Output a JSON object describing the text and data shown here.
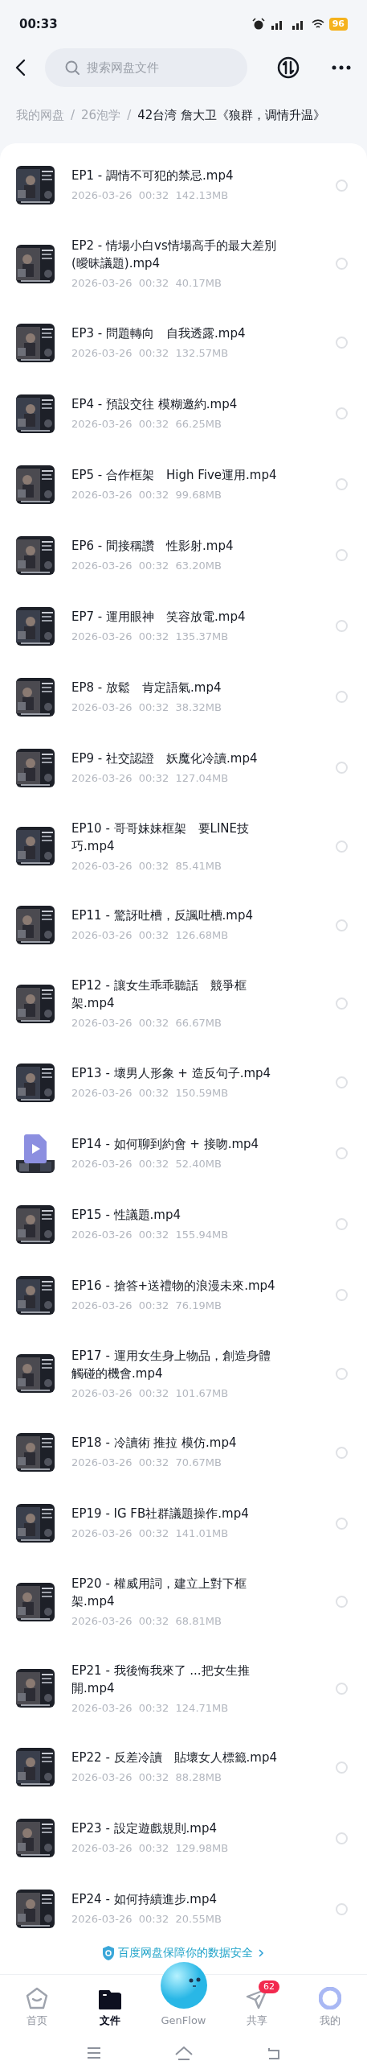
{
  "status_bar": {
    "time": "00:33",
    "battery": "96"
  },
  "search": {
    "placeholder": "搜索网盘文件"
  },
  "breadcrumb": [
    {
      "kind": "crumb",
      "label": "我的网盘",
      "current": false
    },
    {
      "kind": "separator",
      "label": "/"
    },
    {
      "kind": "crumb",
      "label": "26泡学",
      "current": false
    },
    {
      "kind": "separator",
      "label": "/"
    },
    {
      "kind": "crumb",
      "label": "42台湾 詹大卫《狼群，调情升温》",
      "current": true
    }
  ],
  "files": [
    {
      "kind": "picture",
      "name": "EP1 - 調情不可犯的禁忌.mp4",
      "date": "2026-03-26",
      "time": "00:32",
      "size": "142.13MB",
      "selected": false
    },
    {
      "kind": "picture",
      "name": "EP2 - 情場小白vs情場高手的最大差別(曖昧議題).mp4",
      "date": "2026-03-26",
      "time": "00:32",
      "size": "40.17MB",
      "selected": false
    },
    {
      "kind": "picture",
      "name": "EP3 - 問題轉向　自我透露.mp4",
      "date": "2026-03-26",
      "time": "00:32",
      "size": "132.57MB",
      "selected": false
    },
    {
      "kind": "picture",
      "name": "EP4 - 預設交往 模糊邀約.mp4",
      "date": "2026-03-26",
      "time": "00:32",
      "size": "66.25MB",
      "selected": false
    },
    {
      "kind": "picture",
      "name": "EP5 - 合作框架　High Five運用.mp4",
      "date": "2026-03-26",
      "time": "00:32",
      "size": "99.68MB",
      "selected": false
    },
    {
      "kind": "picture",
      "name": "EP6 - 間接稱讚　性影射.mp4",
      "date": "2026-03-26",
      "time": "00:32",
      "size": "63.20MB",
      "selected": false
    },
    {
      "kind": "picture",
      "name": "EP7 - 運用眼神　笑容放電.mp4",
      "date": "2026-03-26",
      "time": "00:32",
      "size": "135.37MB",
      "selected": false
    },
    {
      "kind": "picture",
      "name": "EP8 - 放鬆　肯定語氣.mp4",
      "date": "2026-03-26",
      "time": "00:32",
      "size": "38.32MB",
      "selected": false
    },
    {
      "kind": "picture",
      "name": "EP9 - 社交認證　妖魔化冷讀.mp4",
      "date": "2026-03-26",
      "time": "00:32",
      "size": "127.04MB",
      "selected": false
    },
    {
      "kind": "picture",
      "name": "EP10 - 哥哥妹妹框架　要LINE技巧.mp4",
      "date": "2026-03-26",
      "time": "00:32",
      "size": "85.41MB",
      "selected": false
    },
    {
      "kind": "picture",
      "name": "EP11 - 驚訝吐槽，反諷吐槽.mp4",
      "date": "2026-03-26",
      "time": "00:32",
      "size": "126.68MB",
      "selected": false
    },
    {
      "kind": "picture",
      "name": "EP12 - 讓女生乖乖聽話　競爭框架.mp4",
      "date": "2026-03-26",
      "time": "00:32",
      "size": "66.67MB",
      "selected": false
    },
    {
      "kind": "picture",
      "name": "EP13 - 壞男人形象 + 造反句子.mp4",
      "date": "2026-03-26",
      "time": "00:32",
      "size": "150.59MB",
      "selected": false
    },
    {
      "kind": "video-file",
      "name": "EP14 - 如何聊到約會 + 接吻.mp4",
      "date": "2026-03-26",
      "time": "00:32",
      "size": "52.40MB",
      "selected": false
    },
    {
      "kind": "picture",
      "name": "EP15  - 性議題.mp4",
      "date": "2026-03-26",
      "time": "00:32",
      "size": "155.94MB",
      "selected": false
    },
    {
      "kind": "picture",
      "name": "EP16 - 搶答+送禮物的浪漫未來.mp4",
      "date": "2026-03-26",
      "time": "00:32",
      "size": "76.19MB",
      "selected": false
    },
    {
      "kind": "picture",
      "name": "EP17 - 運用女生身上物品，創造身體觸碰的機會.mp4",
      "date": "2026-03-26",
      "time": "00:32",
      "size": "101.67MB",
      "selected": false
    },
    {
      "kind": "picture",
      "name": "EP18 - 冷讀術 推拉 模仿.mp4",
      "date": "2026-03-26",
      "time": "00:32",
      "size": "70.67MB",
      "selected": false
    },
    {
      "kind": "picture",
      "name": "EP19 - IG FB社群議題操作.mp4",
      "date": "2026-03-26",
      "time": "00:32",
      "size": "141.01MB",
      "selected": false
    },
    {
      "kind": "picture",
      "name": "EP20 - 權威用詞，建立上對下框架.mp4",
      "date": "2026-03-26",
      "time": "00:32",
      "size": "68.81MB",
      "selected": false
    },
    {
      "kind": "picture",
      "name": "EP21 - 我後悔我來了 ...把女生推開.mp4",
      "date": "2026-03-26",
      "time": "00:32",
      "size": "124.71MB",
      "selected": false
    },
    {
      "kind": "picture",
      "name": "EP22 - 反差冷讀　貼壞女人標籤.mp4",
      "date": "2026-03-26",
      "time": "00:32",
      "size": "88.28MB",
      "selected": false
    },
    {
      "kind": "picture",
      "name": "EP23 - 設定遊戲規則.mp4",
      "date": "2026-03-26",
      "time": "00:32",
      "size": "129.98MB",
      "selected": false
    },
    {
      "kind": "picture",
      "name": "EP24 - 如何持續進步.mp4",
      "date": "2026-03-26",
      "time": "00:32",
      "size": "20.55MB",
      "selected": false
    }
  ],
  "security_notice": "百度网盘保障你的数据安全",
  "tabs": [
    {
      "kind": "home",
      "label": "首页",
      "selected": false
    },
    {
      "kind": "files",
      "label": "文件",
      "selected": true
    },
    {
      "kind": "genflow",
      "label": "GenFlow",
      "selected": false
    },
    {
      "kind": "share",
      "label": "共享",
      "selected": false,
      "badge": "62"
    },
    {
      "kind": "me",
      "label": "我的",
      "selected": false
    }
  ]
}
